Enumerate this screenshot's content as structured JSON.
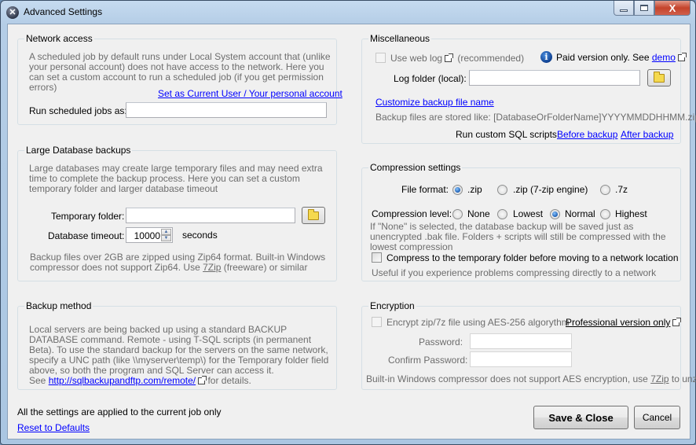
{
  "window": {
    "title": "Advanced Settings",
    "controls": {
      "minimize": "minimize",
      "maximize": "maximize",
      "close": "X"
    }
  },
  "network": {
    "title": "Network access",
    "description": "A scheduled job by default runs under Local System account that (unlike your personal account) does not have access to the network. Here you can set a custom account to run a scheduled job (if you get permission errors)",
    "set_current_user_link": "Set as Current User / Your personal account",
    "run_as_label": "Run scheduled jobs as:",
    "run_as_value": ""
  },
  "large_db": {
    "title": "Large Database backups",
    "description": "Large databases may create large temporary files and may need extra time to complete the backup process. Here you can set a custom temporary folder and larger database timeout",
    "temp_folder_label": "Temporary folder:",
    "temp_folder_value": "",
    "timeout_label": "Database timeout:",
    "timeout_value": "10000",
    "timeout_unit": "seconds",
    "zip64_note_pre": "Backup files over 2GB are zipped using Zip64 format. Built-in Windows compressor does not support Zip64. Use ",
    "zip64_link": "7Zip",
    "zip64_note_post": " (freeware) or similar"
  },
  "backup_method": {
    "title": "Backup method",
    "description": "Local servers are being backed up using a standard BACKUP DATABASE command. Remote - using T-SQL scripts (in permanent Beta). To use the standard backup for the servers on the same network, specify a UNC path (like \\\\myserver\\temp\\) for the Temporary folder field above, so both the program and SQL Server can access it.",
    "see_pre": "See ",
    "see_link": "http://sqlbackupandftp.com/remote/",
    "see_post": " for details."
  },
  "footer": {
    "note": "All the settings are applied to the current job only",
    "reset_link": "Reset to Defaults",
    "save_label": "Save & Close",
    "cancel_label": "Cancel"
  },
  "misc": {
    "title": "Miscellaneous",
    "web_log_label": "Use web log",
    "web_log_note": "(recommended)",
    "web_log_checked": false,
    "paid_note": "Paid version only. See ",
    "demo_link": "demo",
    "log_folder_label": "Log folder (local):",
    "log_folder_value": "",
    "customize_link": "Customize backup file name",
    "stored_like": "Backup files are stored like: [DatabaseOrFolderName]YYYYMMDDHHMM.zip",
    "custom_sql_label": "Run custom SQL scripts:",
    "before_backup_link": "Before backup",
    "after_backup_link": "After backup"
  },
  "compression": {
    "title": "Compression settings",
    "file_format_label": "File format:",
    "file_formats": [
      {
        "label": ".zip",
        "checked": true
      },
      {
        "label": ".zip (7-zip engine)",
        "checked": false
      },
      {
        "label": ".7z",
        "checked": false
      }
    ],
    "level_label": "Compression level:",
    "levels": [
      {
        "label": "None",
        "checked": false
      },
      {
        "label": "Lowest",
        "checked": false
      },
      {
        "label": "Normal",
        "checked": true
      },
      {
        "label": "Highest",
        "checked": false
      }
    ],
    "none_note": "If \"None\" is selected, the database backup will be saved just as unencrypted .bak file. Folders + scripts will still be compressed with the lowest compression",
    "compress_temp_label": "Compress to the temporary folder before moving to a network location",
    "compress_temp_checked": false,
    "compress_temp_note": "Useful if you experience problems compressing directly to a network"
  },
  "encryption": {
    "title": "Encryption",
    "encrypt_label": "Encrypt zip/7z file using AES-256 algorythm",
    "encrypt_checked": false,
    "pro_link": "Professional version only",
    "password_label": "Password:",
    "confirm_label": "Confirm Password:",
    "note_pre": "Built-in Windows compressor does not support AES encryption, use ",
    "note_link": "7Zip",
    "note_post": " to unzip"
  }
}
